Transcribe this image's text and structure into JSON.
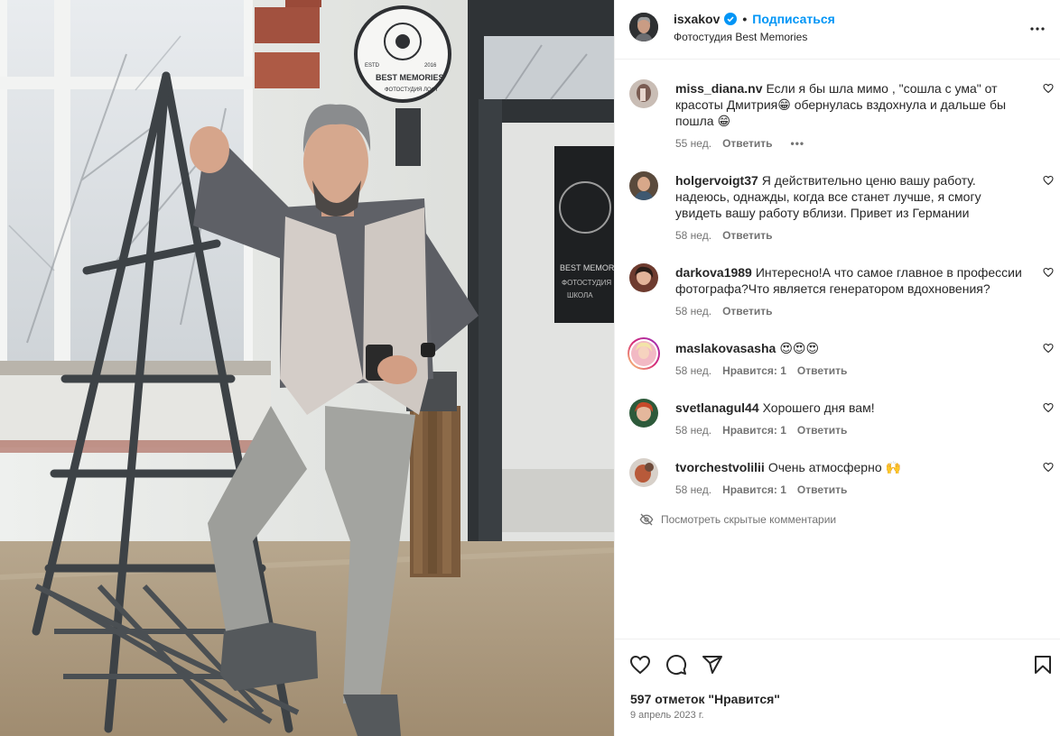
{
  "post": {
    "photo_sign_brand": "BEST MEMORIES",
    "photo_sign_sub": "ФОТОСТУДИЯ ЛОФТ",
    "photo_sign_year_left": "ESTD",
    "photo_sign_year_right": "2016",
    "photo_board_brand": "BEST MEMORIES",
    "photo_board_sub1": "ФОТОСТУДИЯ",
    "photo_board_sub2": "ШКОЛА"
  },
  "header": {
    "username": "isxakov",
    "separator": "•",
    "follow_label": "Подписаться",
    "location": "Фотостудия Best Memories"
  },
  "comments": [
    {
      "user": "miss_diana.nv",
      "text": "Если я бы шла мимо , \"сошла с ума\" от красоты Дмитрия😁 обернулась вздохнула и дальше бы пошла 😁",
      "time": "55 нед.",
      "likes": "",
      "reply": "Ответить",
      "more": "•••"
    },
    {
      "user": "holgervoigt37",
      "text": "Я действительно ценю вашу работу. надеюсь, однажды, когда все станет лучше, я смогу увидеть вашу работу вблизи. Привет из Германии",
      "time": "58 нед.",
      "likes": "",
      "reply": "Ответить"
    },
    {
      "user": "darkova1989",
      "text": "Интересно!А что самое главное в профессии фотографа?Что является генератором вдохновения?",
      "time": "58 нед.",
      "likes": "",
      "reply": "Ответить"
    },
    {
      "user": "maslakovasasha",
      "text": "😍😍😍",
      "time": "58 нед.",
      "likes": "Нравится: 1",
      "reply": "Ответить"
    },
    {
      "user": "svetlanagul44",
      "text": "Хорошего дня вам!",
      "time": "58 нед.",
      "likes": "Нравится: 1",
      "reply": "Ответить"
    },
    {
      "user": "tvorchestvolilii",
      "text": "Очень атмосферно 🙌",
      "time": "58 нед.",
      "likes": "Нравится: 1",
      "reply": "Ответить"
    }
  ],
  "hidden_comments_label": "Посмотреть скрытые комментарии",
  "actions": {
    "like_icon": "heart-icon",
    "comment_icon": "comment-icon",
    "share_icon": "share-icon",
    "save_icon": "bookmark-icon"
  },
  "likes_count": "597 отметок \"Нравится\"",
  "date": "9 апрель 2023 г.",
  "colors": {
    "accent": "#0095f6",
    "text": "#262626",
    "secondary": "#737373",
    "border": "#efefef"
  }
}
